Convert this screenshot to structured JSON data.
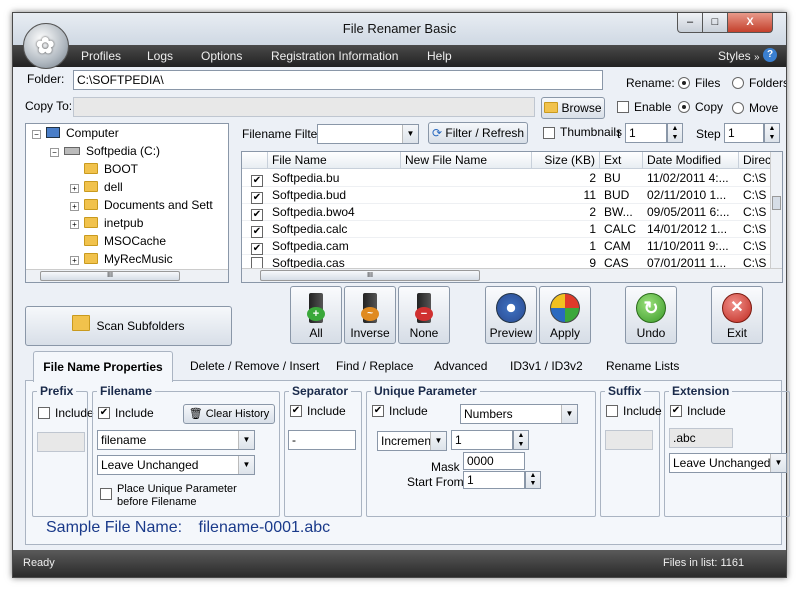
{
  "window": {
    "title": "File Renamer Basic",
    "min": "–",
    "max": "□",
    "close": "X"
  },
  "menu": {
    "items": [
      "Profiles",
      "Logs",
      "Options",
      "Registration Information",
      "Help"
    ],
    "styles": "Styles",
    "styles_arrow": "»",
    "help": "?"
  },
  "folder": {
    "label": "Folder:",
    "value": "C:\\SOFTPEDIA\\"
  },
  "copyto": {
    "label": "Copy To:",
    "value": "",
    "browse": "Browse"
  },
  "rename": {
    "label": "Rename:",
    "files": "Files",
    "folders": "Folders",
    "enable": "Enable",
    "copy": "Copy",
    "move": "Move"
  },
  "tree": {
    "items": [
      {
        "label": "Computer",
        "icon": "computer-icon",
        "expander": "−"
      },
      {
        "label": "Softpedia (C:)",
        "icon": "drive-icon",
        "expander": "−"
      },
      {
        "label": "BOOT",
        "icon": "folder-icon",
        "expander": ""
      },
      {
        "label": "dell",
        "icon": "folder-icon",
        "expander": "+"
      },
      {
        "label": "Documents and Sett",
        "icon": "folder-icon",
        "expander": "+"
      },
      {
        "label": "inetpub",
        "icon": "folder-icon",
        "expander": "+"
      },
      {
        "label": "MSOCache",
        "icon": "folder-icon",
        "expander": ""
      },
      {
        "label": "MyRecMusic",
        "icon": "folder-icon",
        "expander": "+"
      }
    ],
    "scroll_grip": "III"
  },
  "filter": {
    "label": "Filename Filter:",
    "value": "",
    "refresh": "Filter / Refresh",
    "thumbnails": "Thumbnails",
    "start_val": "1",
    "step_label": "Step",
    "step_val": "1",
    "start_prefix": "t"
  },
  "table": {
    "headers": [
      "",
      "File Name",
      "New File Name",
      "Size (KB)",
      "Ext",
      "Date Modified",
      "Direc"
    ],
    "rows": [
      [
        "✔",
        "Softpedia.bu",
        "",
        "2",
        "BU",
        "11/02/2011 4:...",
        "C:\\S"
      ],
      [
        "✔",
        "Softpedia.bud",
        "",
        "11",
        "BUD",
        "02/11/2010 1...",
        "C:\\S"
      ],
      [
        "✔",
        "Softpedia.bwo4",
        "",
        "2",
        "BW...",
        "09/05/2011 6:...",
        "C:\\S"
      ],
      [
        "✔",
        "Softpedia.calc",
        "",
        "1",
        "CALC",
        "14/01/2012 1...",
        "C:\\S"
      ],
      [
        "✔",
        "Softpedia.cam",
        "",
        "1",
        "CAM",
        "11/10/2011 9:...",
        "C:\\S"
      ],
      [
        "",
        "Softpedia.cas",
        "",
        "9",
        "CAS",
        "07/01/2011 1...",
        "C:\\S"
      ]
    ],
    "scroll_grip": "III"
  },
  "actions": {
    "scan": "Scan Subfolders",
    "all": "All",
    "inverse": "Inverse",
    "none": "None",
    "preview": "Preview",
    "apply": "Apply",
    "undo": "Undo",
    "exit": "Exit"
  },
  "tabs": [
    "File Name Properties",
    "Delete / Remove / Insert",
    "Find / Replace",
    "Advanced",
    "ID3v1 / ID3v2",
    "Rename Lists"
  ],
  "props": {
    "prefix": {
      "title": "Prefix",
      "include": "Include",
      "value": ""
    },
    "filename": {
      "title": "Filename",
      "include": "Include",
      "clear": "Clear History",
      "value": "filename",
      "mode": "Leave Unchanged",
      "place_unique": "Place Unique Parameter before Filename"
    },
    "separator": {
      "title": "Separator",
      "include": "Include",
      "value": "-"
    },
    "unique": {
      "title": "Unique Parameter",
      "include": "Include",
      "type": "Numbers",
      "method": "Increment",
      "value": "1",
      "mask_label": "Mask",
      "mask": "0000",
      "start_label": "Start From:",
      "start": "1"
    },
    "suffix": {
      "title": "Suffix",
      "include": "Include",
      "value": ""
    },
    "extension": {
      "title": "Extension",
      "include": "Include",
      "value": ".abc",
      "mode": "Leave Unchanged"
    }
  },
  "sample": {
    "label": "Sample File Name:",
    "value": "filename-0001.abc"
  },
  "status": {
    "left": "Ready",
    "right": "Files in list: 1161"
  },
  "colors": {
    "accent": "#1a3a8a",
    "menubar": "#2a2a2a"
  }
}
